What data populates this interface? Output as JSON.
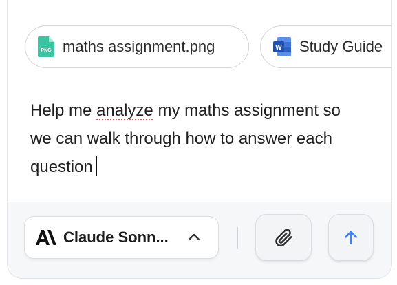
{
  "attachments": [
    {
      "name": "maths assignment.png",
      "type": "PNG",
      "icon": "png-file-icon",
      "color": "#3cc4a2"
    },
    {
      "name": "Study Guide",
      "type": "W",
      "icon": "word-file-icon",
      "color": "#2b5ccc"
    }
  ],
  "message": {
    "before": "Help me ",
    "misspelled": "analyze",
    "after": " my maths assignment so we can walk through how to answer each question"
  },
  "model": {
    "label": "Claude Sonn...",
    "logo": "anthropic-logo-icon"
  },
  "buttons": {
    "attach_icon": "paperclip-icon",
    "send_icon": "arrow-up-icon"
  },
  "colors": {
    "send_accent": "#3b82f6",
    "spell_underline": "#e0565b"
  }
}
